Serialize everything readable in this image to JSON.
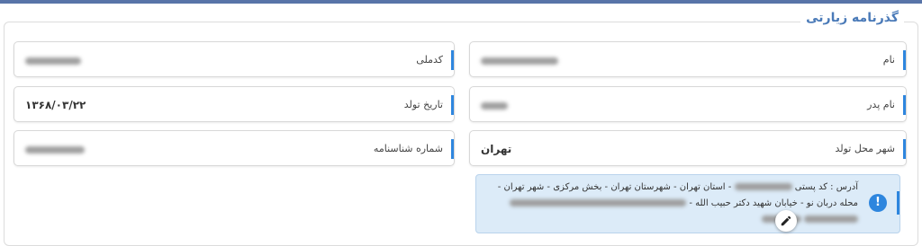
{
  "section": {
    "title": "گذرنامه زیارتی"
  },
  "fields": {
    "name": {
      "label": "نام",
      "value": ""
    },
    "national_code": {
      "label": "کدملی",
      "value": ""
    },
    "father_name": {
      "label": "نام پدر",
      "value": ""
    },
    "birth_date": {
      "label": "تاریخ تولد",
      "value": "۱۳۶۸/۰۳/۲۲"
    },
    "birth_city": {
      "label": "شهر محل تولد",
      "value": "تهران"
    },
    "id_number": {
      "label": "شماره شناسنامه",
      "value": ""
    }
  },
  "address": {
    "line1": "آدرس : کد پستی",
    "line1b": "- استان تهران - شهرستان تهران - بخش مرکزی - شهر تهران -",
    "line2": "محله دربان نو - خیابان شهید دکتر حبیب الله -",
    "icon": "exclamation-icon"
  },
  "colors": {
    "accent": "#2e86de",
    "title": "#4a7ab8",
    "info_bg": "#dcebf8"
  },
  "edit_icon": "pencil-icon"
}
